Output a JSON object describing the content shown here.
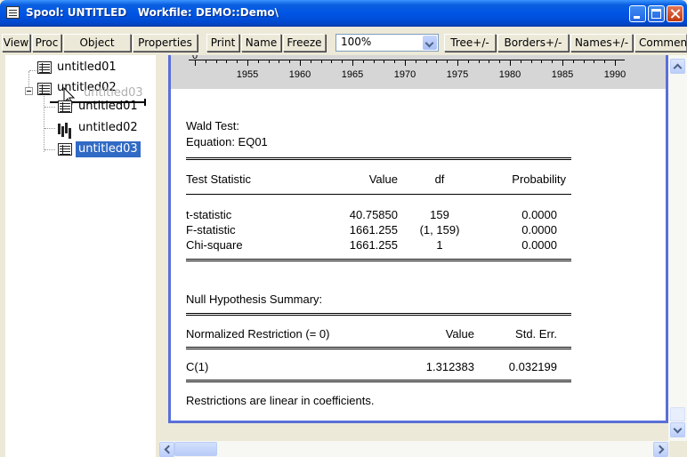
{
  "window": {
    "title": "Spool: UNTITLED   Workfile: DEMO::Demo\\"
  },
  "toolbar": {
    "view": "View",
    "proc": "Proc",
    "object": "Object",
    "properties": "Properties",
    "print": "Print",
    "name": "Name",
    "freeze": "Freeze",
    "zoom": "100%",
    "tree": "Tree+/-",
    "borders": "Borders+/-",
    "names": "Names+/-",
    "comments": "Comments"
  },
  "tree": {
    "items": [
      {
        "label": "untitled01",
        "icon": "table-icon"
      },
      {
        "label": "untitled02",
        "icon": "spool-icon",
        "children": [
          {
            "label": "untitled01",
            "icon": "table-icon"
          },
          {
            "label": "untitled02",
            "icon": "graph-icon"
          },
          {
            "label": "untitled03",
            "icon": "table-icon",
            "selected": true
          }
        ]
      }
    ],
    "drag_ghost": "untitled03"
  },
  "chart_strip": {
    "zero": "0",
    "ticks": [
      "1955",
      "1960",
      "1965",
      "1970",
      "1975",
      "1980",
      "1985",
      "1990"
    ]
  },
  "report": {
    "title": "Wald Test:",
    "equation": "Equation: EQ01",
    "test_headers": [
      "Test Statistic",
      "Value",
      "df",
      "Probability"
    ],
    "test_rows": [
      [
        "t-statistic",
        "40.75850",
        "159",
        "0.0000"
      ],
      [
        "F-statistic",
        "1661.255",
        "(1, 159)",
        "0.0000"
      ],
      [
        "Chi-square",
        "1661.255",
        "1",
        "0.0000"
      ]
    ],
    "null_title": "Null Hypothesis Summary:",
    "null_headers": [
      "Normalized Restriction (= 0)",
      "Value",
      "Std. Err."
    ],
    "null_rows": [
      [
        "C(1)",
        "1.312383",
        "0.032199"
      ]
    ],
    "footer": "Restrictions are linear in coefficients."
  }
}
